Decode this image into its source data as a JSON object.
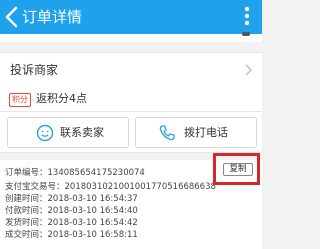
{
  "header": {
    "title": "订单详情",
    "background_color": "#1fa1ec"
  },
  "complain": {
    "label": "投诉商家"
  },
  "points": {
    "badge": "积分",
    "text": "返积分4点"
  },
  "actions": {
    "contact_label": "联系卖家",
    "call_label": "拨打电话"
  },
  "order_info": {
    "order_no": "订单编号：134085654175230074",
    "alipay_no": "支付宝交易号：2018031021001001770516686638",
    "created": "创建时间：2018-03-10 16:54:37",
    "paid": "付款时间：2018-03-10 16:54:40",
    "shipped": "发货时间：2018-03-10 16:54:42",
    "completed": "成交时间：2018-03-10 16:58:11"
  },
  "copy": {
    "label": "复制",
    "highlight_color": "#d3272b"
  },
  "icons": [
    "back-arrow-icon",
    "more-vertical-icon",
    "chevron-right-icon",
    "smile-chat-icon",
    "phone-icon"
  ]
}
